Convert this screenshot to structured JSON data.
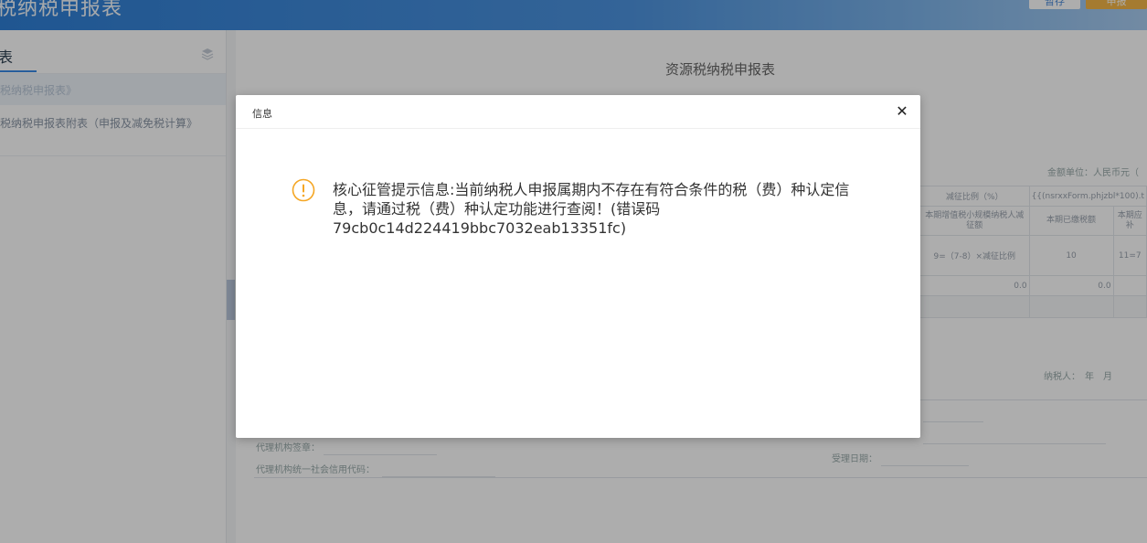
{
  "header": {
    "title": "税纳税申报表",
    "save_label": "暂存",
    "submit_label": "申报"
  },
  "sidebar": {
    "title": "表",
    "items": [
      {
        "label": "税纳税申报表》"
      },
      {
        "label": "税纳税申报表附表（申报及减免税计算》"
      }
    ]
  },
  "main": {
    "title": "资源税纳税申报表",
    "unit": "金额单位：人民币元（",
    "table": {
      "row1": [
        "减征比例（%）",
        "{{(nsrxxForm.phjzbl*100).t"
      ],
      "row2": [
        "本期增值税小规模纳税人减征额",
        "本期已缴税额",
        "本期应补"
      ],
      "row3": [
        "9=（7-8）×减征比例",
        "10",
        "11=7"
      ],
      "row4": [
        "0.0",
        "0.0",
        ""
      ]
    },
    "taxpayer": "纳税人：　年　月",
    "agent_sign": "代理机构签章：",
    "agent_code": "代理机构统一社会信用代码：",
    "accept_date": "受理日期："
  },
  "dialog": {
    "title": "信息",
    "message": "核心征管提示信息:当前纳税人申报属期内不存在有符合条件的税（费）种认定信息，请通过税（费）种认定功能进行查阅！(错误码79cb0c14d224419bbc7032eab13351fc)",
    "warning_color": "#f5a623"
  }
}
